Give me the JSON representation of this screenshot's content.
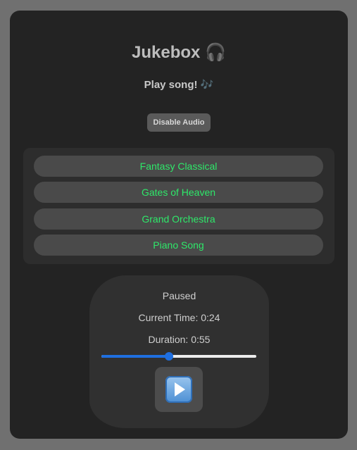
{
  "app": {
    "title": "Jukebox",
    "title_icon": "🎧",
    "subtitle": "Play song!",
    "subtitle_icon": "🎶"
  },
  "controls": {
    "disable_audio_label": "Disable Audio"
  },
  "songs": [
    {
      "title": "Fantasy Classical"
    },
    {
      "title": "Gates of Heaven"
    },
    {
      "title": "Grand Orchestra"
    },
    {
      "title": "Piano Song"
    }
  ],
  "player": {
    "status": "Paused",
    "current_time_label": "Current Time: 0:24",
    "duration_label": "Duration: 0:55",
    "progress": 0.436,
    "play_icon": "play-button-icon"
  },
  "colors": {
    "song_text": "#2ee86a",
    "slider_accent": "#1f6fe0"
  }
}
